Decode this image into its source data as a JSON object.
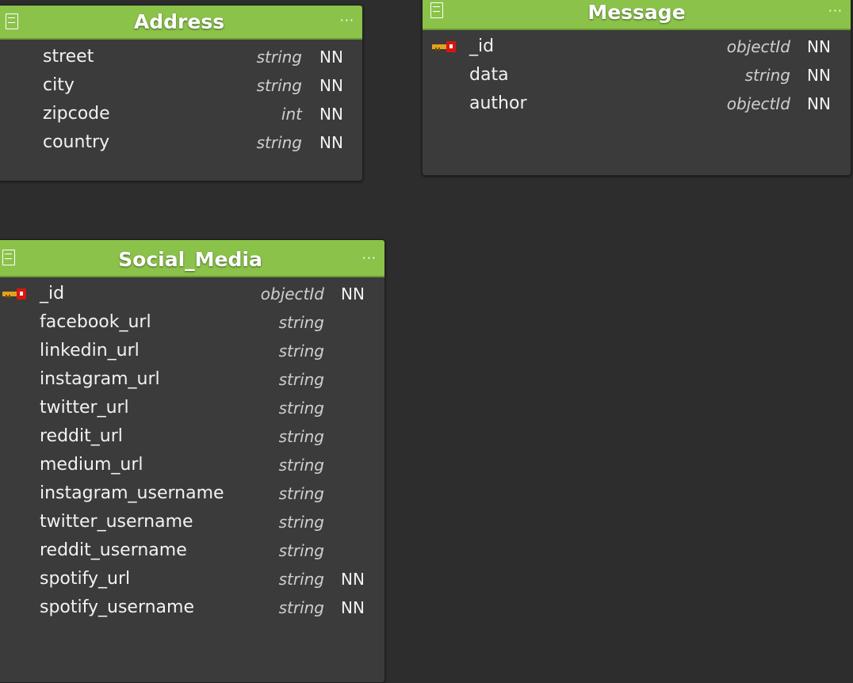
{
  "entities": {
    "address": {
      "title": "Address",
      "fields": [
        {
          "name": "street",
          "type": "string",
          "nn": "NN",
          "pk": false
        },
        {
          "name": "city",
          "type": "string",
          "nn": "NN",
          "pk": false
        },
        {
          "name": "zipcode",
          "type": "int",
          "nn": "NN",
          "pk": false
        },
        {
          "name": "country",
          "type": "string",
          "nn": "NN",
          "pk": false
        }
      ]
    },
    "message": {
      "title": "Message",
      "fields": [
        {
          "name": "_id",
          "type": "objectId",
          "nn": "NN",
          "pk": true
        },
        {
          "name": "data",
          "type": "string",
          "nn": "NN",
          "pk": false
        },
        {
          "name": "author",
          "type": "objectId",
          "nn": "NN",
          "pk": false
        }
      ]
    },
    "social_media": {
      "title": "Social_Media",
      "fields": [
        {
          "name": "_id",
          "type": "objectId",
          "nn": "NN",
          "pk": true
        },
        {
          "name": "facebook_url",
          "type": "string",
          "nn": "",
          "pk": false
        },
        {
          "name": "linkedin_url",
          "type": "string",
          "nn": "",
          "pk": false
        },
        {
          "name": "instagram_url",
          "type": "string",
          "nn": "",
          "pk": false
        },
        {
          "name": "twitter_url",
          "type": "string",
          "nn": "",
          "pk": false
        },
        {
          "name": "reddit_url",
          "type": "string",
          "nn": "",
          "pk": false
        },
        {
          "name": "medium_url",
          "type": "string",
          "nn": "",
          "pk": false
        },
        {
          "name": "instagram_username",
          "type": "string",
          "nn": "",
          "pk": false
        },
        {
          "name": "twitter_username",
          "type": "string",
          "nn": "",
          "pk": false
        },
        {
          "name": "reddit_username",
          "type": "string",
          "nn": "",
          "pk": false
        },
        {
          "name": "spotify_url",
          "type": "string",
          "nn": "NN",
          "pk": false
        },
        {
          "name": "spotify_username",
          "type": "string",
          "nn": "NN",
          "pk": false
        }
      ]
    }
  },
  "ui": {
    "more_label": "···",
    "icons": {
      "table": "table-icon",
      "more": "more-icon",
      "primary_key": "primary-key-icon"
    },
    "colors": {
      "header": "#8bc34a",
      "body": "#3b3b3b",
      "canvas": "#2d2d2d",
      "pk_key": "#e3a21c",
      "pk_head": "#d7160f"
    }
  }
}
